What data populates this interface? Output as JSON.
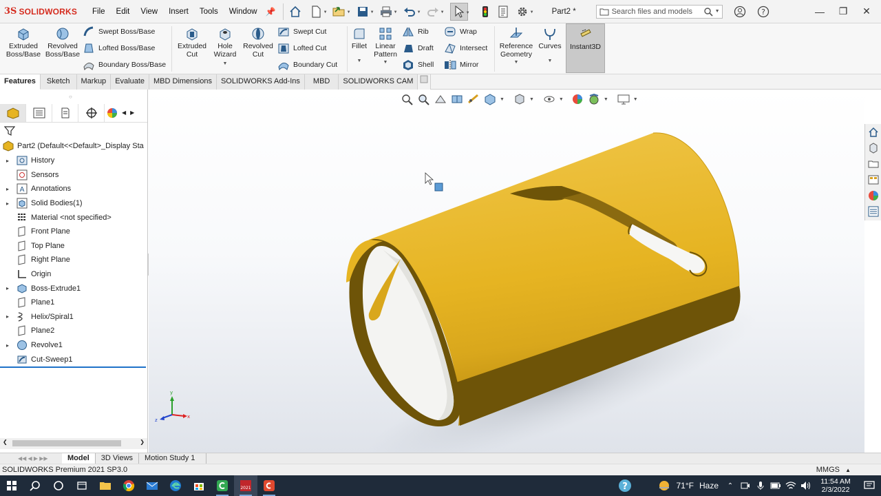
{
  "app": {
    "logo_ds": "3S",
    "logo_text": "SOLIDWORKS",
    "doc_title": "Part2 *",
    "accent": "#d52b1e"
  },
  "menu": [
    "File",
    "Edit",
    "View",
    "Insert",
    "Tools",
    "Window"
  ],
  "search": {
    "placeholder": "Search files and models"
  },
  "ribbon": {
    "extruded_boss": "Extruded\nBoss/Base",
    "revolved_boss": "Revolved\nBoss/Base",
    "swept_boss": "Swept Boss/Base",
    "lofted_boss": "Lofted Boss/Base",
    "boundary_boss": "Boundary Boss/Base",
    "extruded_cut": "Extruded\nCut",
    "hole_wizard": "Hole\nWizard",
    "revolved_cut": "Revolved\nCut",
    "swept_cut": "Swept Cut",
    "lofted_cut": "Lofted Cut",
    "boundary_cut": "Boundary Cut",
    "fillet": "Fillet",
    "linear_pattern": "Linear\nPattern",
    "rib": "Rib",
    "draft": "Draft",
    "shell": "Shell",
    "wrap": "Wrap",
    "intersect": "Intersect",
    "mirror": "Mirror",
    "reference_geometry": "Reference\nGeometry",
    "curves": "Curves",
    "instant3d": "Instant3D"
  },
  "tabs": [
    "Features",
    "Sketch",
    "Markup",
    "Evaluate",
    "MBD Dimensions",
    "SOLIDWORKS Add-Ins",
    "MBD",
    "SOLIDWORKS CAM"
  ],
  "tree": {
    "root": "Part2  (Default<<Default>_Display Sta",
    "items": [
      {
        "label": "History",
        "expand": true
      },
      {
        "label": "Sensors",
        "expand": false
      },
      {
        "label": "Annotations",
        "expand": true
      },
      {
        "label": "Solid Bodies(1)",
        "expand": true
      },
      {
        "label": "Material <not specified>",
        "expand": false
      },
      {
        "label": "Front Plane",
        "expand": false
      },
      {
        "label": "Top Plane",
        "expand": false
      },
      {
        "label": "Right Plane",
        "expand": false
      },
      {
        "label": "Origin",
        "expand": false
      },
      {
        "label": "Boss-Extrude1",
        "expand": true
      },
      {
        "label": "Plane1",
        "expand": false
      },
      {
        "label": "Helix/Spiral1",
        "expand": true
      },
      {
        "label": "Plane2",
        "expand": false
      },
      {
        "label": "Revolve1",
        "expand": true
      },
      {
        "label": "Cut-Sweep1",
        "expand": false
      }
    ]
  },
  "model": {
    "color": "#e6b422",
    "shade": "#6e5408"
  },
  "model_tabs": [
    "Model",
    "3D Views",
    "Motion Study 1"
  ],
  "status": {
    "text": "SOLIDWORKS Premium 2021 SP3.0",
    "units": "MMGS"
  },
  "taskbar": {
    "weather_temp": "71°F",
    "weather_text": "Haze",
    "time": "11:54 AM",
    "date": "2/3/2022"
  },
  "triad": {
    "x": "x",
    "y": "y",
    "z": "z"
  }
}
